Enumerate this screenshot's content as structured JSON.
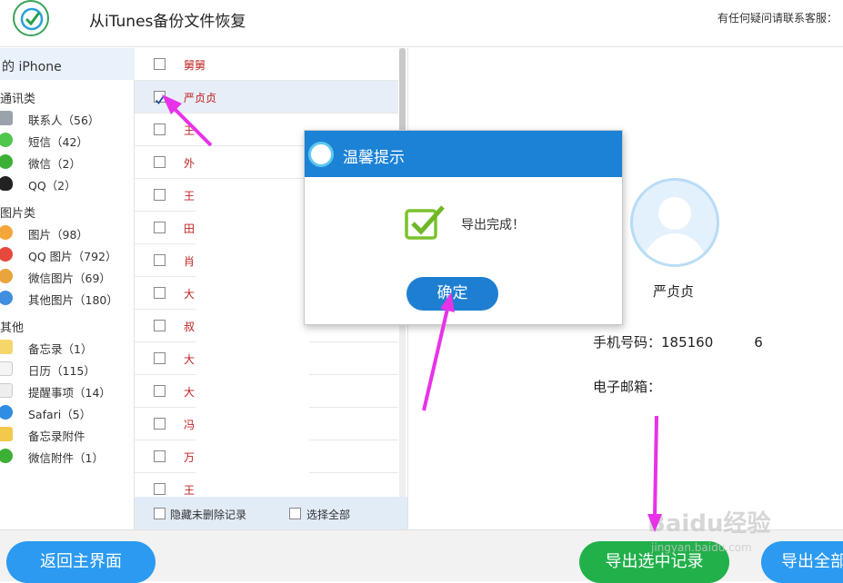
{
  "header": {
    "title": "从iTunes备份文件恢复",
    "contact": "有任何疑问请联系客服："
  },
  "sidebar": {
    "device": "的 iPhone",
    "groups": [
      {
        "title": "通讯类",
        "items": [
          {
            "label": "联系人（56）",
            "icon": "contacts-icon"
          },
          {
            "label": "短信（42）",
            "icon": "messages-icon"
          },
          {
            "label": "微信（2）",
            "icon": "wechat-icon"
          },
          {
            "label": "QQ（2）",
            "icon": "qq-icon"
          }
        ]
      },
      {
        "title": "图片类",
        "items": [
          {
            "label": "图片（98）",
            "icon": "photos-icon"
          },
          {
            "label": "QQ 图片（792）",
            "icon": "qq-photos-icon"
          },
          {
            "label": "微信图片（69）",
            "icon": "wechat-photos-icon"
          },
          {
            "label": "其他图片（180）",
            "icon": "other-photos-icon"
          }
        ]
      },
      {
        "title": "其他",
        "items": [
          {
            "label": "备忘录（1）",
            "icon": "notes-icon"
          },
          {
            "label": "日历（115）",
            "icon": "calendar-icon"
          },
          {
            "label": "提醒事项（14）",
            "icon": "reminders-icon"
          },
          {
            "label": "Safari（5）",
            "icon": "safari-icon"
          },
          {
            "label": "备忘录附件",
            "icon": "notes-attachment-icon"
          },
          {
            "label": "微信附件（1）",
            "icon": "wechat-attachment-icon"
          }
        ]
      }
    ]
  },
  "list": {
    "rows": [
      {
        "name": "舅舅",
        "checked": false
      },
      {
        "name": "严贞贞",
        "checked": true
      },
      {
        "name": "王",
        "checked": false
      },
      {
        "name": "外",
        "checked": false
      },
      {
        "name": "王",
        "checked": false
      },
      {
        "name": "田",
        "checked": false
      },
      {
        "name": "肖",
        "checked": false
      },
      {
        "name": "大",
        "checked": false
      },
      {
        "name": "叔",
        "checked": false
      },
      {
        "name": "大",
        "checked": false
      },
      {
        "name": "大",
        "checked": false
      },
      {
        "name": "冯",
        "checked": false
      },
      {
        "name": "万",
        "checked": false
      },
      {
        "name": "王",
        "checked": false
      }
    ],
    "footer": {
      "hide_deleted": "隐藏未删除记录",
      "select_all": "选择全部"
    }
  },
  "detail": {
    "name": "严贞贞",
    "phone": "手机号码：185160　　　6",
    "email": "电子邮箱："
  },
  "dialog": {
    "title": "温馨提示",
    "message": "导出完成！",
    "ok": "确定"
  },
  "bottom": {
    "back": "返回主界面",
    "export_selected": "导出选中记录",
    "export_all": "导出全部"
  },
  "watermark": {
    "brand": "Baidu经验",
    "url": "jingyan.baidu.com"
  },
  "colors": {
    "accent_blue": "#1b82d6",
    "export_green": "#22b04b",
    "annotation_arrow": "#e832e8",
    "contact_name_red": "#c02222"
  }
}
